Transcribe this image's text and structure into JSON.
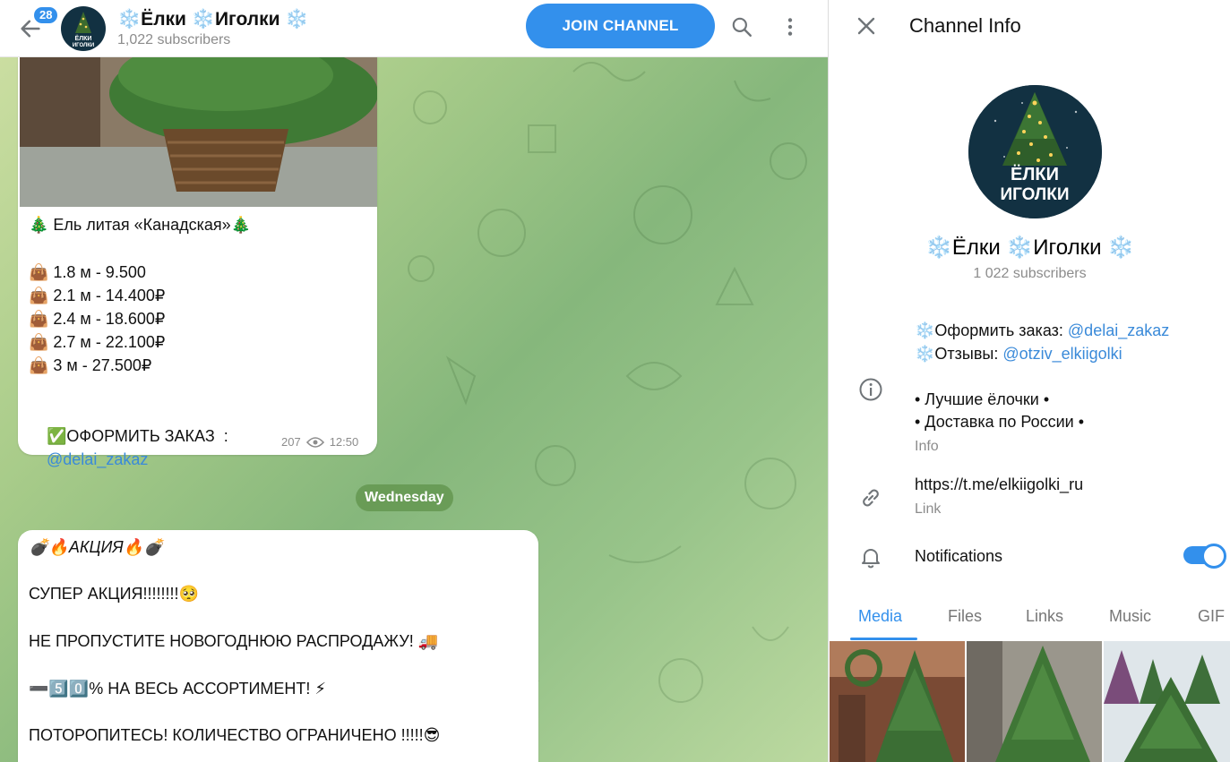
{
  "topbar": {
    "unread_count": "28",
    "channel_title": "❄️Ёлки ❄️Иголки ❄️",
    "subscribers": "1,022 subscribers",
    "join_label": "JOIN CHANNEL",
    "avatar_text_line1": "ЁЛКИ",
    "avatar_text_line2": "ИГОЛКИ"
  },
  "messages": [
    {
      "title": "🎄 Ель литая «Канадская»🎄",
      "prices": [
        "👜 1.8 м - 9.500",
        "👜 2.1 м - 14.400₽",
        "👜 2.4 м - 18.600₽",
        "👜 2.7 м - 22.100₽",
        "👜 3 м - 27.500₽"
      ],
      "order_label": "✅ОФОРМИТЬ ЗАКАЗ  :",
      "order_link": "@delai_zakaz",
      "views": "207",
      "time": "12:50"
    },
    {
      "lines": [
        "💣🔥АКЦИЯ🔥💣",
        "СУПЕР АКЦИЯ!!!!!!!!🥺",
        "НЕ ПРОПУСТИТЕ НОВОГОДНЮЮ РАСПРОДАЖУ! 🚚",
        "➖5️⃣0️⃣% НА ВЕСЬ АССОРТИМЕНТ! ⚡",
        "ПОТОРОПИТЕСЬ! КОЛИЧЕСТВО ОГРАНИЧЕНО !!!!!😎"
      ]
    }
  ],
  "date_separator": "Wednesday",
  "panel": {
    "header_title": "Channel Info",
    "name": "❄️Ёлки ❄️Иголки ❄️",
    "subscribers": "1 022 subscribers",
    "avatar_text_line1": "ЁЛКИ",
    "avatar_text_line2": "ИГОЛКИ",
    "order_prefix": "❄️Оформить заказ: ",
    "order_link": "@delai_zakaz",
    "reviews_prefix": "❄️Отзывы: ",
    "reviews_link": "@otziv_elkiigolki",
    "desc_line1": "• Лучшие ёлочки •",
    "desc_line2": "• Доставка по России •",
    "info_caption": "Info",
    "link_value": "https://t.me/elkiigolki_ru",
    "link_caption": "Link",
    "notifications_label": "Notifications",
    "notifications_on": true,
    "tabs": [
      "Media",
      "Files",
      "Links",
      "Music",
      "GIF"
    ]
  },
  "colors": {
    "accent": "#3390ec",
    "link": "#3a8ad9",
    "muted": "#8c8c8c"
  }
}
